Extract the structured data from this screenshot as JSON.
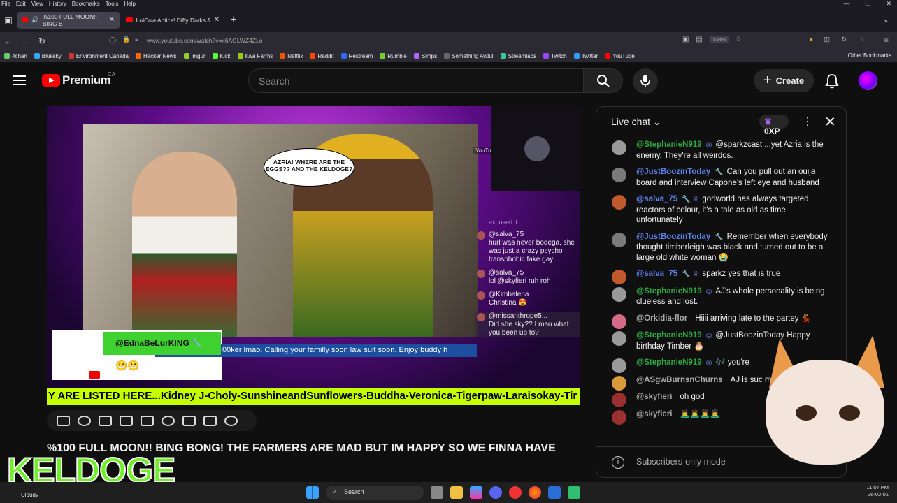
{
  "menubar": {
    "items": [
      "File",
      "Edit",
      "View",
      "History",
      "Bookmarks",
      "Tools",
      "Help"
    ]
  },
  "tabs": [
    {
      "title": "%100 FULL MOON!! BING B"
    },
    {
      "title": "LolCow Antics! Diffy Dorks & Th"
    }
  ],
  "url": "www.youtube.com/watch?v=x6AGLWZ4ZLo",
  "zoom": "133%",
  "bookmarks": [
    "4chan",
    "Bluesky",
    "Environment Canada",
    "Hacker News",
    "imgur",
    "Kick",
    "Kiwi Farms",
    "Netflix",
    "Reddit",
    "Restream",
    "Rumble",
    "Simps",
    "Something Awful",
    "Streamlabs",
    "Twitch",
    "Twitter",
    "YouTube"
  ],
  "bookmark_colors": [
    "#6c6",
    "#3af",
    "#c33",
    "#f60",
    "#9c3",
    "#5f3",
    "#9c0",
    "#e50",
    "#f40",
    "#36f",
    "#7c3",
    "#a6f",
    "#666",
    "#3c9",
    "#94f",
    "#39f",
    "#f00"
  ],
  "other_bookmarks": "Other Bookmarks",
  "header": {
    "brand": "Premium",
    "region": "CA",
    "search_placeholder": "Search",
    "create_label": "Create"
  },
  "video": {
    "speech_bubble": "AZRIA! WHERE ARE THE EGGS?? AND THE KELDOGE?",
    "watermark": "YouTube",
    "stream_chat_hint": "exposed it",
    "stream_chat": [
      {
        "author": "@salva_75",
        "text": "hurl was never bodega, she was just a crazy psycho transphobic fake gay"
      },
      {
        "author": "@salva_75",
        "text": "lol @skyfieri ruh roh"
      },
      {
        "author": "@Kimbalena",
        "text": "Christina 😍"
      },
      {
        "author": "@missanthrope5...",
        "text": "Did she sky?? Lmao what you been up to?"
      }
    ],
    "alert_name": "@EdnaBeLurKING",
    "alert_emoji": "😬😬",
    "ticker": "00ker lmao. Calling your familly soon law suit soon. Enjoy buddy h",
    "bottom_ticker": "Y ARE LISTED HERE...Kidney J-Choly-SunshineandSunflowers-Buddha-Veronica-Tigerpaw-Laraisokay-Tir"
  },
  "video_title": "%100 FULL MOON!! BING BONG! THE FARMERS ARE MAD BUT IM HAPPY SO WE FINNA HAVE",
  "overlay_logo": "KELDOGE",
  "chat": {
    "title": "Live chat",
    "xp": "0XP",
    "messages": [
      {
        "author": "@StephanieN919",
        "color": "green",
        "avatar": "#9a9a9a",
        "badge": "◎",
        "text": "@sparkzcast ...yet Azria is the enemy. They're all weirdos."
      },
      {
        "author": "@JustBoozinToday",
        "color": "blue",
        "avatar": "#7a7a7a",
        "badge": "🔧",
        "text": "Can you pull out an ouija board and interview Capone's left eye and husband"
      },
      {
        "author": "@salva_75",
        "color": "blue",
        "avatar": "#c05a2c",
        "badge": "🔧 ♕",
        "text": "gorlworld has always targeted reactors of colour, it's a tale as old as time unfortunately"
      },
      {
        "author": "@JustBoozinToday",
        "color": "blue",
        "avatar": "#7a7a7a",
        "badge": "🔧",
        "text": "Remember when everybody thought timberleigh was black and turned out to be a large old white woman 😭"
      },
      {
        "author": "@salva_75",
        "color": "blue",
        "avatar": "#c05a2c",
        "badge": "🔧 ♕",
        "text": "sparkz yes that is true"
      },
      {
        "author": "@StephanieN919",
        "color": "green",
        "avatar": "#9a9a9a",
        "badge": "◎",
        "text": "AJ's whole personality is being clueless and lost."
      },
      {
        "author": "@Orkidia-flor",
        "color": "gray",
        "avatar": "#d46a86",
        "badge": "",
        "text": "Hiiii arriving late to the partey 💃"
      },
      {
        "author": "@StephanieN919",
        "color": "green",
        "avatar": "#9a9a9a",
        "badge": "◎",
        "text": "@JustBoozinToday Happy birthday Timber 🎂"
      },
      {
        "author": "@StephanieN919",
        "color": "green",
        "avatar": "#9a9a9a",
        "badge": "◎",
        "text": "🎶 you're"
      },
      {
        "author": "@ASgwBurnsnChurns",
        "color": "gray",
        "avatar": "#d89a3a",
        "badge": "",
        "text": "AJ is suc moron"
      },
      {
        "author": "@skyfieri",
        "color": "gray",
        "avatar": "#9a3030",
        "badge": "",
        "text": "oh god"
      },
      {
        "author": "@skyfieri",
        "color": "gray",
        "avatar": "#9a3030",
        "badge": "",
        "text": "🙇‍♂️🙇‍♂️🙇‍♂️🙇‍♂️"
      }
    ],
    "subscribers_only": "Subscribers-only mode"
  },
  "taskbar": {
    "weather": "Cloudy",
    "search": "Search",
    "time": "11:07 PM",
    "date": "26-02-01"
  }
}
